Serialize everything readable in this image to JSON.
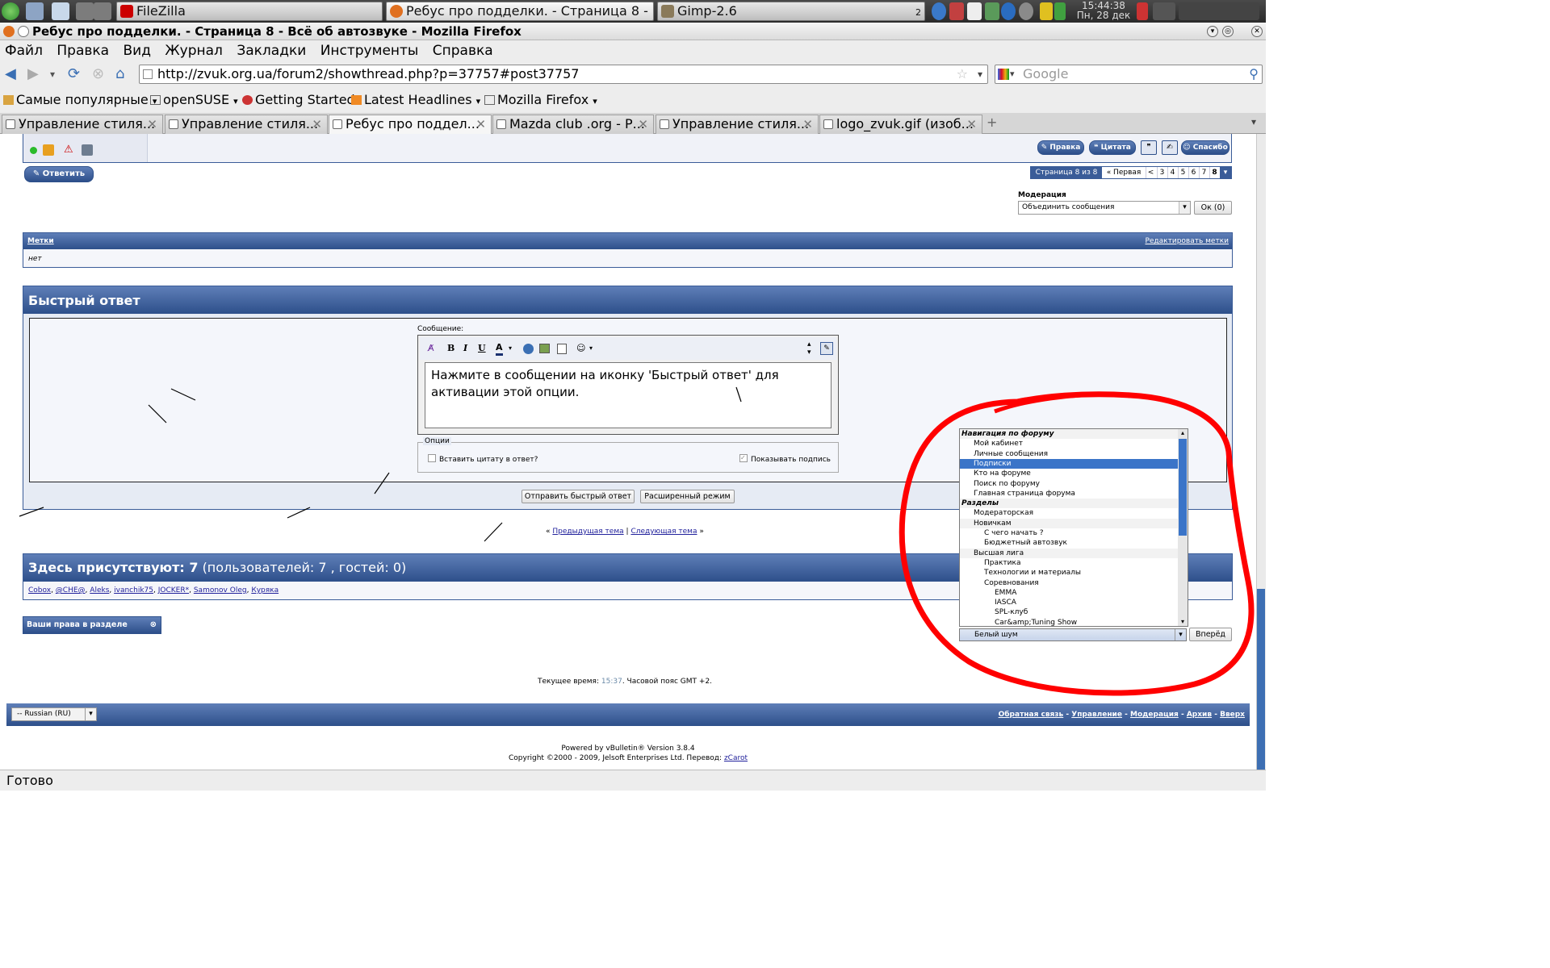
{
  "taskbar": {
    "tasks": [
      {
        "label": "FileZilla"
      },
      {
        "label": "Ребус про подделки. - Страница 8 - Всё"
      },
      {
        "label": "Gimp-2.6"
      }
    ],
    "task_count": "2",
    "clock_time": "15:44:38",
    "clock_date": "Пн, 28 дек"
  },
  "window": {
    "title": "Ребус про подделки. - Страница 8 - Всё об автозвуке - Mozilla Firefox"
  },
  "menu": [
    "Файл",
    "Правка",
    "Вид",
    "Журнал",
    "Закладки",
    "Инструменты",
    "Справка"
  ],
  "nav": {
    "url": "http://zvuk.org.ua/forum2/showthread.php?p=37757#post37757",
    "search_placeholder": "Google"
  },
  "bookmarks": [
    "Самые популярные",
    "openSUSE",
    "Getting Started",
    "Latest Headlines",
    "Mozilla Firefox"
  ],
  "tabs": [
    {
      "label": "Управление стиля..."
    },
    {
      "label": "Управление стиля..."
    },
    {
      "label": "Ребус про поддел..."
    },
    {
      "label": "Mazda club .org - Р..."
    },
    {
      "label": "Управление стиля..."
    },
    {
      "label": "logo_zvuk.gif (изоб..."
    }
  ],
  "post_actions": {
    "edit": "Правка",
    "quote": "Цитата",
    "thanks": "Спасибо"
  },
  "reply_button": "Ответить",
  "pagination": {
    "info": "Страница 8 из 8",
    "first": "« Первая",
    "prev": "<",
    "pages": [
      "3",
      "4",
      "5",
      "6",
      "7",
      "8"
    ],
    "current": "8"
  },
  "moderation": {
    "label": "Модерация",
    "selected": "Объединить сообщения",
    "ok_button": "Ок (0)"
  },
  "tags": {
    "title": "Метки",
    "edit_link": "Редактировать метки",
    "value": "нет"
  },
  "quick_reply": {
    "title": "Быстрый ответ",
    "message_label": "Сообщение:",
    "editor_text": "Нажмите в сообщении на иконку 'Быстрый ответ' для активации этой опции.",
    "options_legend": "Опции",
    "quote_checkbox": "Вставить цитату в ответ?",
    "signature_checkbox": "Показывать подпись",
    "submit_button": "Отправить быстрый ответ",
    "advanced_button": "Расширенный режим"
  },
  "thread_nav": {
    "prev_open": "«",
    "prev": "Предыдущая тема",
    "sep": "|",
    "next": "Следующая тема",
    "next_close": "»"
  },
  "online": {
    "title_bold": "Здесь присутствуют: 7",
    "title_rest": "(пользователей: 7 , гостей: 0)",
    "users": [
      "Cobox",
      "@CHE@",
      "Aleks",
      "ivanchik75",
      "JOCKER*",
      "Samonov Oleg",
      "Куряка"
    ]
  },
  "rights_box": "Ваши права в разделе",
  "forum_jump": {
    "items": [
      {
        "text": "Навигация по форуму",
        "level": 0,
        "header": true
      },
      {
        "text": "Мой кабинет",
        "level": 1
      },
      {
        "text": "Личные сообщения",
        "level": 1
      },
      {
        "text": "Подписки",
        "level": 1,
        "selected": true
      },
      {
        "text": "Кто на форуме",
        "level": 1
      },
      {
        "text": "Поиск по форуму",
        "level": 1
      },
      {
        "text": "Главная страница форума",
        "level": 1
      },
      {
        "text": "Разделы",
        "level": 0,
        "header": true
      },
      {
        "text": "Модераторская",
        "level": 1
      },
      {
        "text": "Новичкам",
        "level": 1
      },
      {
        "text": "С чего начать ?",
        "level": 2
      },
      {
        "text": "Бюджетный автозвук",
        "level": 2
      },
      {
        "text": "Высшая лига",
        "level": 1
      },
      {
        "text": "Практика",
        "level": 2
      },
      {
        "text": "Технологии и материалы",
        "level": 2
      },
      {
        "text": "Соревнования",
        "level": 2
      },
      {
        "text": "EMMA",
        "level": 3
      },
      {
        "text": "IASCA",
        "level": 3
      },
      {
        "text": "SPL-клуб",
        "level": 3
      },
      {
        "text": "Car&amp;Tuning Show",
        "level": 3
      }
    ],
    "selected_value": "Белый шум",
    "go_button": "Вперёд"
  },
  "time_line": {
    "prefix": "Текущее время:",
    "time": "15:37",
    "suffix": ". Часовой пояс GMT +2."
  },
  "footer": {
    "language": "-- Russian (RU)",
    "links": [
      "Обратная связь",
      "Управление",
      "Модерация",
      "Архив",
      "Вверх"
    ],
    "sep": "-",
    "powered": "Powered by vBulletin® Version 3.8.4",
    "copyright": "Copyright ©2000 - 2009, Jelsoft Enterprises Ltd. Перевод:",
    "translator": "zCarot"
  },
  "status": "Готово",
  "colors": {
    "accent": "#3a5c98",
    "annotation_red": "#ff0000",
    "selection": "#3a74c8"
  }
}
